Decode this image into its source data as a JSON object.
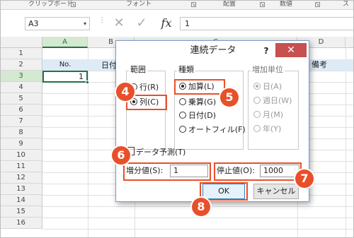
{
  "ribbon": {
    "groups": [
      {
        "label": "クリップボード"
      },
      {
        "label": "フォント"
      },
      {
        "label": "配置"
      },
      {
        "label": "数値"
      },
      {
        "label": "ス"
      }
    ],
    "launcher_icon": "dialog-launcher-icon"
  },
  "formula_bar": {
    "name_box": "A3",
    "dropdown_icon": "▾",
    "cancel_icon": "✕",
    "enter_icon": "✓",
    "fx_label": "fx",
    "value": "1"
  },
  "sheet": {
    "columns": [
      "A",
      "B",
      "C",
      "D"
    ],
    "rows": [
      "1",
      "2",
      "3",
      "4",
      "5",
      "6",
      "7",
      "8",
      "9",
      "10",
      "11",
      "12",
      "13",
      "14",
      "15",
      "16"
    ],
    "selected_cell": "A3",
    "a2": "No.",
    "b2": "日付",
    "e2": "備考",
    "a3": "1"
  },
  "dialog": {
    "title": "連続データ",
    "help": "?",
    "close": "✕",
    "range_group": "範囲",
    "range_options": [
      {
        "label": "行(R)",
        "selected": false
      },
      {
        "label": "列(C)",
        "selected": true
      }
    ],
    "type_group": "種類",
    "type_options": [
      {
        "label": "加算(L)",
        "selected": true
      },
      {
        "label": "乗算(G)",
        "selected": false
      },
      {
        "label": "日付(D)",
        "selected": false
      },
      {
        "label": "オートフィル(F)",
        "selected": false
      }
    ],
    "unit_group": "増加単位",
    "unit_options": [
      {
        "label": "日(A)",
        "selected": true
      },
      {
        "label": "週日(W)",
        "selected": false
      },
      {
        "label": "月(M)",
        "selected": false
      },
      {
        "label": "年(Y)",
        "selected": false
      }
    ],
    "predict_label": "データ予測(T)",
    "step_label": "増分値(S):",
    "step_value": "1",
    "stop_label": "停止値(O):",
    "stop_value": "1000",
    "ok_label": "OK",
    "cancel_label": "キャンセル"
  },
  "callouts": [
    "4",
    "5",
    "6",
    "7",
    "8"
  ],
  "colors": {
    "accent": "#e8502a",
    "excel_green": "#217346",
    "header_band": "#ddebf7",
    "close_red": "#c75050"
  }
}
